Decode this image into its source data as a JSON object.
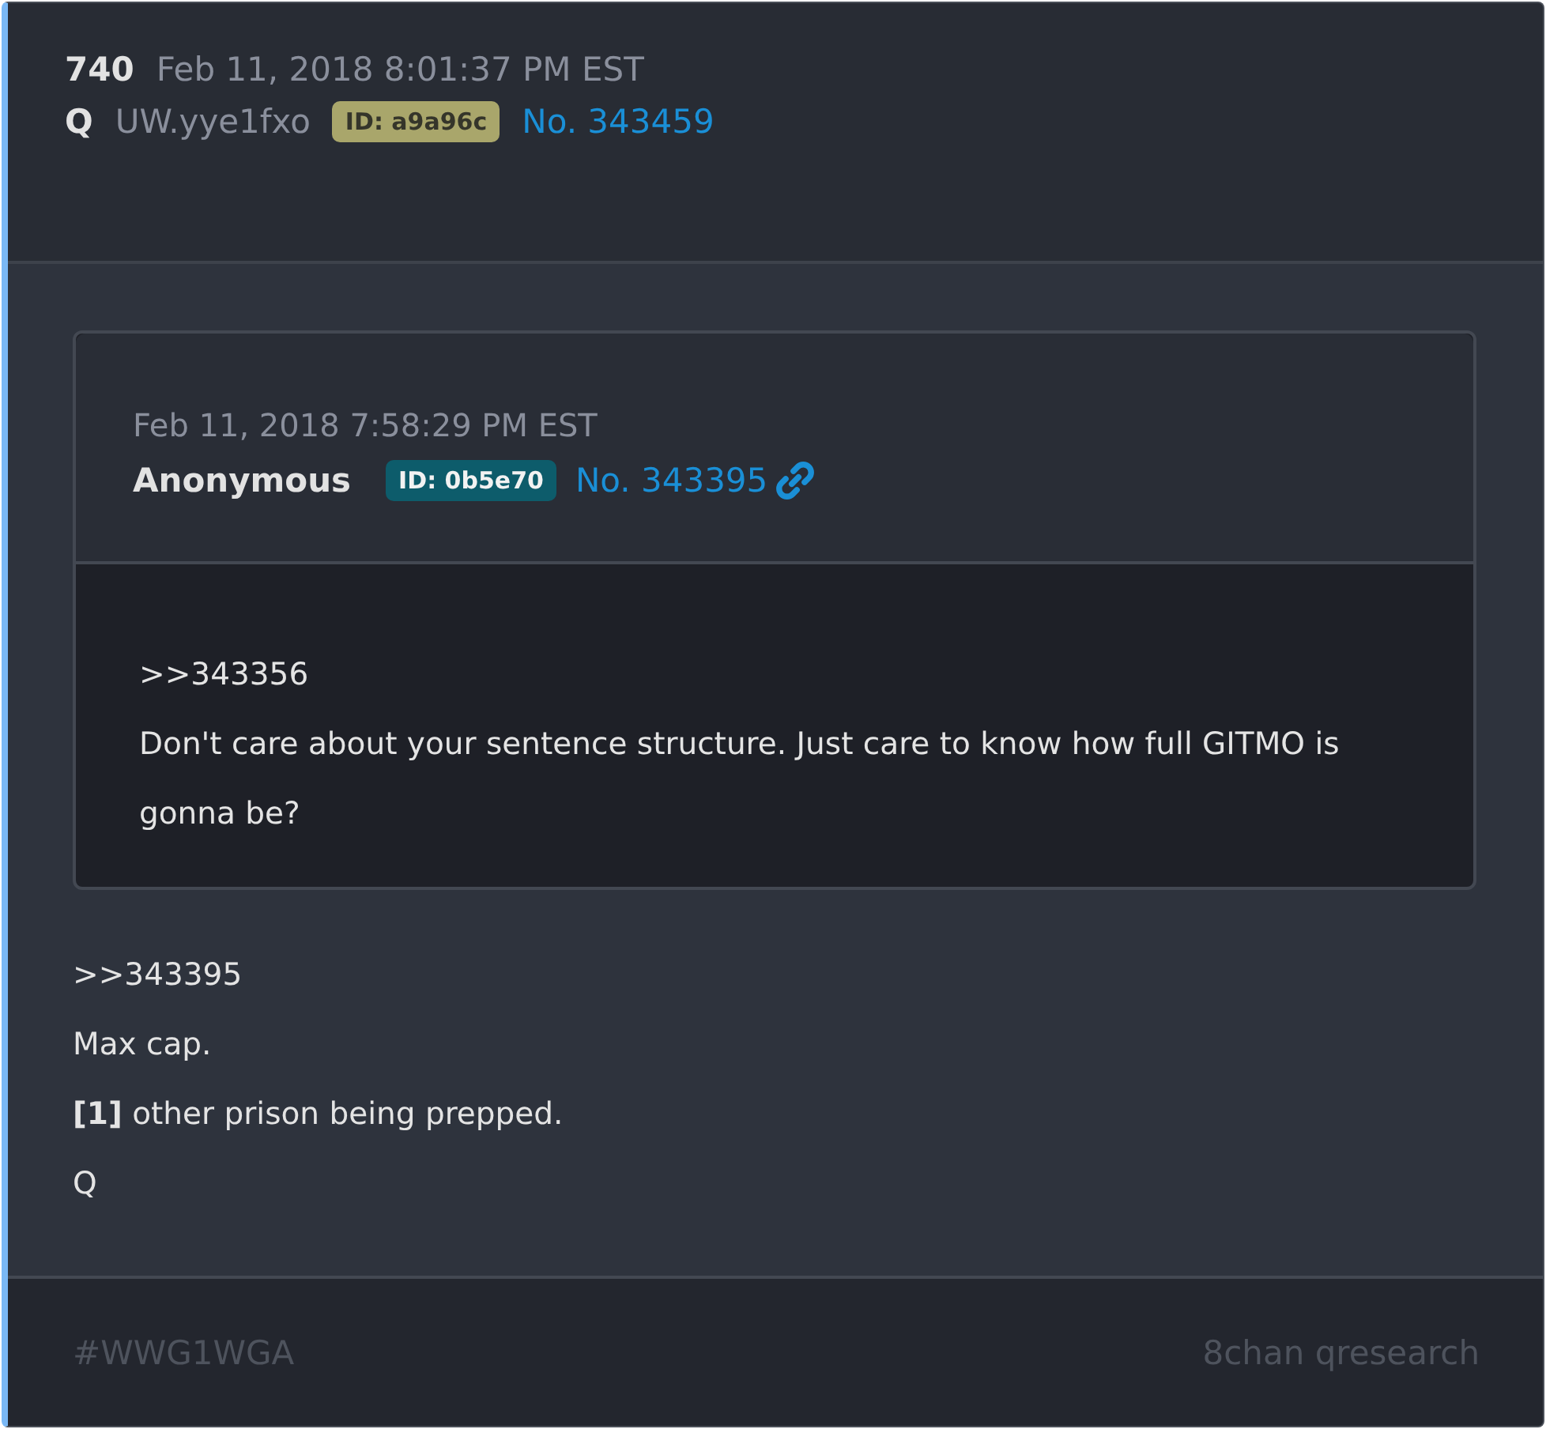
{
  "post": {
    "number": "740",
    "date": "Feb 11, 2018 8:01:37 PM EST",
    "author": "Q",
    "tripcode": "UW.yye1fxo",
    "id": {
      "label": "ID: a9a96c",
      "color": "#a9a66b"
    },
    "post_no": "No. 343459"
  },
  "quote": {
    "date": "Feb 11, 2018 7:58:29 PM EST",
    "author": "Anonymous",
    "id": {
      "label": "ID: 0b5e70",
      "color": "#0d5c6b"
    },
    "post_no": "No. 343395",
    "lines": [
      ">>343356",
      "Don't care about your sentence structure. Just care to know how full GITMO is gonna be?"
    ]
  },
  "body": [
    ">>343395",
    "Max cap.",
    "**[1]** other prison being prepped.",
    "Q"
  ],
  "footer": {
    "hashtag": "#WWG1WGA",
    "source": "8chan qresearch"
  }
}
